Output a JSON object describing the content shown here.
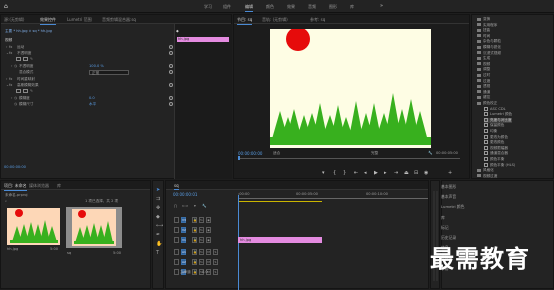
{
  "menubar": {
    "workspaces": [
      "学习",
      "组件",
      "编辑",
      "颜色",
      "效果",
      "音频",
      "图形",
      "库"
    ],
    "active_index": 2
  },
  "left_panel": {
    "tabs": [
      "源:(无剪辑)",
      "效果控件",
      "Lumetri 范围",
      "音频剪辑混合器:sq"
    ],
    "active_tab": 1,
    "source_line": "主要 * hh.jpg  ∨  sq * hh.jpg",
    "video_header": "视频",
    "rows": [
      {
        "label": "运动"
      },
      {
        "label": "不透明度"
      },
      {
        "label": "不透明度",
        "value": "100.0 %"
      },
      {
        "label": "混合模式",
        "value": "正常"
      },
      {
        "label": "时间重映射"
      },
      {
        "label": "高斯模糊效果"
      },
      {
        "label": "模糊度",
        "value": "0.0"
      },
      {
        "label": "模糊尺寸",
        "value": "水平"
      }
    ],
    "timecode": "00:00:00:00",
    "clip_label": "hh.jpg"
  },
  "program_monitor": {
    "tabs": [
      "节目: sq",
      "音轨: (无剪辑)",
      "参考: sq"
    ],
    "active_tab": 0,
    "timecode_left": "00:00:00:00",
    "fit": "适合",
    "quality": "完整",
    "timecode_right": "00:00:05:00"
  },
  "effects_panel": {
    "items": [
      {
        "label": "变换",
        "type": "folder"
      },
      {
        "label": "实用程序",
        "type": "folder"
      },
      {
        "label": "扭曲",
        "type": "folder"
      },
      {
        "label": "时间",
        "type": "folder"
      },
      {
        "label": "杂色与颗粒",
        "type": "folder"
      },
      {
        "label": "模糊与锐化",
        "type": "folder"
      },
      {
        "label": "沉浸式视频",
        "type": "folder"
      },
      {
        "label": "生成",
        "type": "folder"
      },
      {
        "label": "视频",
        "type": "folder"
      },
      {
        "label": "调整",
        "type": "folder"
      },
      {
        "label": "过时",
        "type": "folder"
      },
      {
        "label": "过渡",
        "type": "folder"
      },
      {
        "label": "透视",
        "type": "folder"
      },
      {
        "label": "通道",
        "type": "folder"
      },
      {
        "label": "键控",
        "type": "folder"
      },
      {
        "label": "颜色校正",
        "type": "folder"
      },
      {
        "label": "ASC CDL",
        "type": "fx"
      },
      {
        "label": "Lumetri 颜色",
        "type": "fx"
      },
      {
        "label": "亮度与对比度",
        "type": "fx"
      },
      {
        "label": "保留颜色",
        "type": "fx"
      },
      {
        "label": "均衡",
        "type": "fx"
      },
      {
        "label": "更改为颜色",
        "type": "fx"
      },
      {
        "label": "更改颜色",
        "type": "fx"
      },
      {
        "label": "视频限幅器",
        "type": "fx"
      },
      {
        "label": "通道混合器",
        "type": "fx"
      },
      {
        "label": "颜色平衡",
        "type": "fx"
      },
      {
        "label": "颜色平衡 (HLS)",
        "type": "fx"
      },
      {
        "label": "风格化",
        "type": "folder"
      },
      {
        "label": "视频过渡",
        "type": "folder"
      }
    ],
    "selected_index": 18
  },
  "project_panel": {
    "tabs": [
      "项目: 未命名",
      "媒体浏览器",
      "库"
    ],
    "active_tab": 0,
    "project_name": "未命名.prproj",
    "selection": "1 项已选择，共 2 项",
    "thumbs": [
      {
        "label": "hh.jpg",
        "duration": "5:00"
      },
      {
        "label": "sq",
        "duration": "5:00"
      }
    ]
  },
  "timeline": {
    "tab": "sq",
    "timecode": "00:00:00:01",
    "ruler_marks": [
      ":00:00",
      "00:00:05:00",
      "00:00:10:00"
    ],
    "video_tracks": [
      "V3",
      "V2",
      "V1"
    ],
    "audio_tracks": [
      "A1",
      "A2",
      "A3"
    ],
    "master_label": "主声道",
    "master_value": "0.0",
    "clip_label": "hh.jpg"
  },
  "essential_graphics": {
    "items": [
      "基本图形",
      "基本声音",
      "Lumetri 颜色",
      "库",
      "标记",
      "历史记录",
      "信息",
      "元数据",
      "字幕"
    ]
  },
  "watermark": "最需教育",
  "colors": {
    "clip_pink": "#e48be0",
    "sun_red": "#e60b0b",
    "tree_green": "#38b01e",
    "frame_bg": "#fefde4",
    "accent_blue": "#4a8ad4"
  }
}
